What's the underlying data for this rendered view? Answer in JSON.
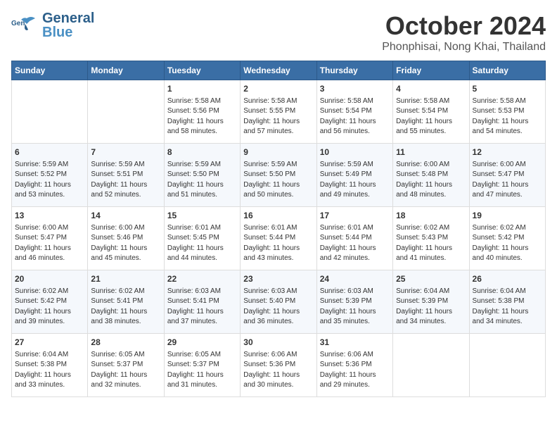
{
  "header": {
    "logo": {
      "general": "General",
      "blue": "Blue"
    },
    "month": "October 2024",
    "location": "Phonphisai, Nong Khai, Thailand"
  },
  "weekdays": [
    "Sunday",
    "Monday",
    "Tuesday",
    "Wednesday",
    "Thursday",
    "Friday",
    "Saturday"
  ],
  "weeks": [
    [
      {
        "day": "",
        "info": ""
      },
      {
        "day": "",
        "info": ""
      },
      {
        "day": "1",
        "info": "Sunrise: 5:58 AM\nSunset: 5:56 PM\nDaylight: 11 hours\nand 58 minutes."
      },
      {
        "day": "2",
        "info": "Sunrise: 5:58 AM\nSunset: 5:55 PM\nDaylight: 11 hours\nand 57 minutes."
      },
      {
        "day": "3",
        "info": "Sunrise: 5:58 AM\nSunset: 5:54 PM\nDaylight: 11 hours\nand 56 minutes."
      },
      {
        "day": "4",
        "info": "Sunrise: 5:58 AM\nSunset: 5:54 PM\nDaylight: 11 hours\nand 55 minutes."
      },
      {
        "day": "5",
        "info": "Sunrise: 5:58 AM\nSunset: 5:53 PM\nDaylight: 11 hours\nand 54 minutes."
      }
    ],
    [
      {
        "day": "6",
        "info": "Sunrise: 5:59 AM\nSunset: 5:52 PM\nDaylight: 11 hours\nand 53 minutes."
      },
      {
        "day": "7",
        "info": "Sunrise: 5:59 AM\nSunset: 5:51 PM\nDaylight: 11 hours\nand 52 minutes."
      },
      {
        "day": "8",
        "info": "Sunrise: 5:59 AM\nSunset: 5:50 PM\nDaylight: 11 hours\nand 51 minutes."
      },
      {
        "day": "9",
        "info": "Sunrise: 5:59 AM\nSunset: 5:50 PM\nDaylight: 11 hours\nand 50 minutes."
      },
      {
        "day": "10",
        "info": "Sunrise: 5:59 AM\nSunset: 5:49 PM\nDaylight: 11 hours\nand 49 minutes."
      },
      {
        "day": "11",
        "info": "Sunrise: 6:00 AM\nSunset: 5:48 PM\nDaylight: 11 hours\nand 48 minutes."
      },
      {
        "day": "12",
        "info": "Sunrise: 6:00 AM\nSunset: 5:47 PM\nDaylight: 11 hours\nand 47 minutes."
      }
    ],
    [
      {
        "day": "13",
        "info": "Sunrise: 6:00 AM\nSunset: 5:47 PM\nDaylight: 11 hours\nand 46 minutes."
      },
      {
        "day": "14",
        "info": "Sunrise: 6:00 AM\nSunset: 5:46 PM\nDaylight: 11 hours\nand 45 minutes."
      },
      {
        "day": "15",
        "info": "Sunrise: 6:01 AM\nSunset: 5:45 PM\nDaylight: 11 hours\nand 44 minutes."
      },
      {
        "day": "16",
        "info": "Sunrise: 6:01 AM\nSunset: 5:44 PM\nDaylight: 11 hours\nand 43 minutes."
      },
      {
        "day": "17",
        "info": "Sunrise: 6:01 AM\nSunset: 5:44 PM\nDaylight: 11 hours\nand 42 minutes."
      },
      {
        "day": "18",
        "info": "Sunrise: 6:02 AM\nSunset: 5:43 PM\nDaylight: 11 hours\nand 41 minutes."
      },
      {
        "day": "19",
        "info": "Sunrise: 6:02 AM\nSunset: 5:42 PM\nDaylight: 11 hours\nand 40 minutes."
      }
    ],
    [
      {
        "day": "20",
        "info": "Sunrise: 6:02 AM\nSunset: 5:42 PM\nDaylight: 11 hours\nand 39 minutes."
      },
      {
        "day": "21",
        "info": "Sunrise: 6:02 AM\nSunset: 5:41 PM\nDaylight: 11 hours\nand 38 minutes."
      },
      {
        "day": "22",
        "info": "Sunrise: 6:03 AM\nSunset: 5:41 PM\nDaylight: 11 hours\nand 37 minutes."
      },
      {
        "day": "23",
        "info": "Sunrise: 6:03 AM\nSunset: 5:40 PM\nDaylight: 11 hours\nand 36 minutes."
      },
      {
        "day": "24",
        "info": "Sunrise: 6:03 AM\nSunset: 5:39 PM\nDaylight: 11 hours\nand 35 minutes."
      },
      {
        "day": "25",
        "info": "Sunrise: 6:04 AM\nSunset: 5:39 PM\nDaylight: 11 hours\nand 34 minutes."
      },
      {
        "day": "26",
        "info": "Sunrise: 6:04 AM\nSunset: 5:38 PM\nDaylight: 11 hours\nand 34 minutes."
      }
    ],
    [
      {
        "day": "27",
        "info": "Sunrise: 6:04 AM\nSunset: 5:38 PM\nDaylight: 11 hours\nand 33 minutes."
      },
      {
        "day": "28",
        "info": "Sunrise: 6:05 AM\nSunset: 5:37 PM\nDaylight: 11 hours\nand 32 minutes."
      },
      {
        "day": "29",
        "info": "Sunrise: 6:05 AM\nSunset: 5:37 PM\nDaylight: 11 hours\nand 31 minutes."
      },
      {
        "day": "30",
        "info": "Sunrise: 6:06 AM\nSunset: 5:36 PM\nDaylight: 11 hours\nand 30 minutes."
      },
      {
        "day": "31",
        "info": "Sunrise: 6:06 AM\nSunset: 5:36 PM\nDaylight: 11 hours\nand 29 minutes."
      },
      {
        "day": "",
        "info": ""
      },
      {
        "day": "",
        "info": ""
      }
    ]
  ]
}
